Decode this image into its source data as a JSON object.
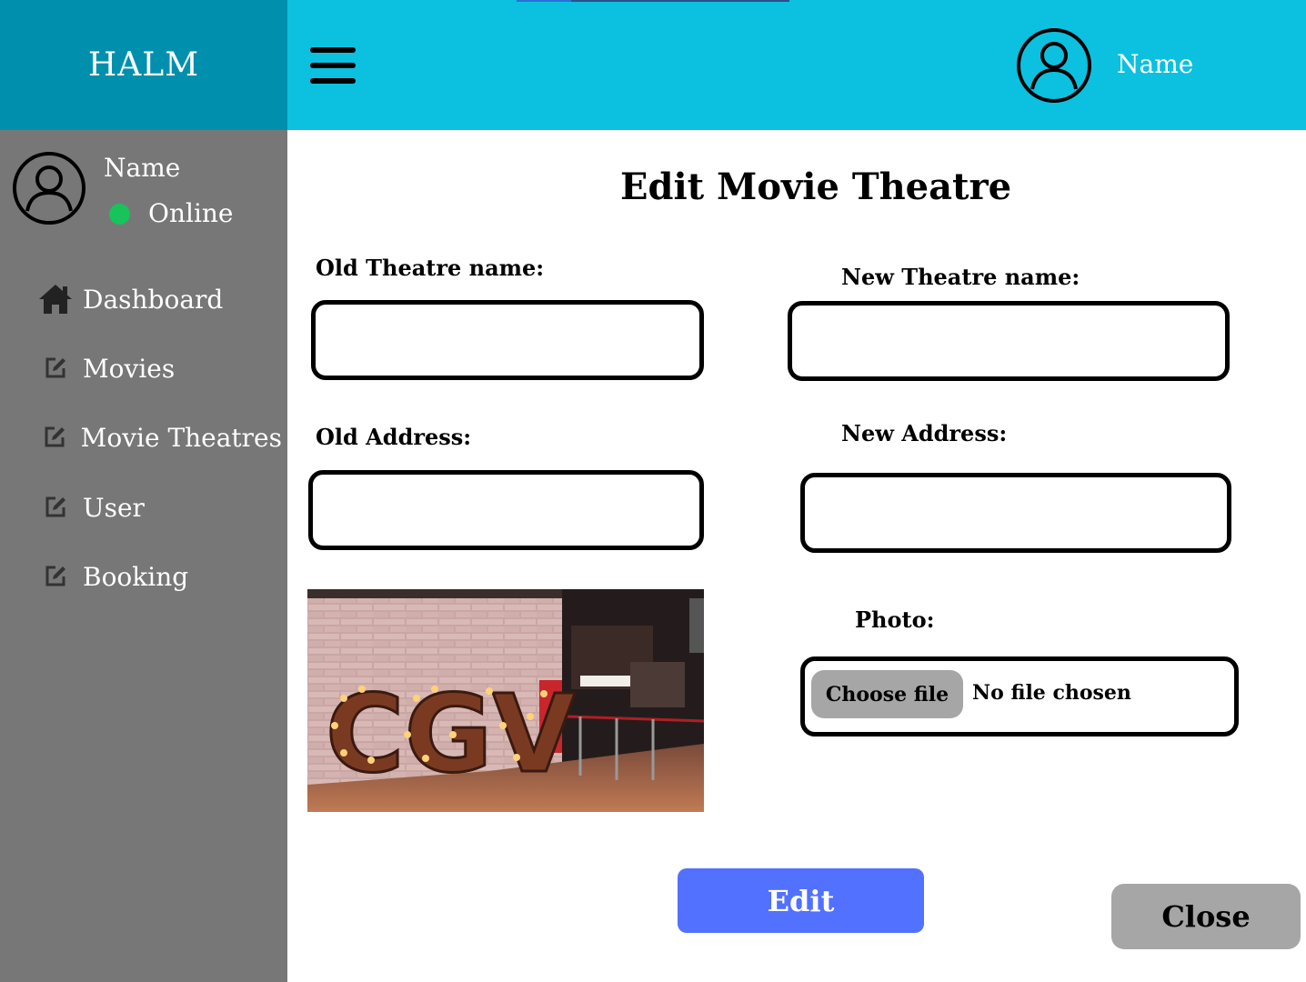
{
  "brand": {
    "title": "HALM"
  },
  "header": {
    "user_name": "Name",
    "menu_icon": "hamburger-menu-icon",
    "avatar_icon": "user-circle-icon"
  },
  "sidebar": {
    "user_name": "Name",
    "status": "Online",
    "status_color": "#16c45a",
    "items": [
      {
        "label": "Dashboard",
        "icon": "home-icon"
      },
      {
        "label": "Movies",
        "icon": "edit-icon"
      },
      {
        "label": "Movie Theatres",
        "icon": "edit-icon"
      },
      {
        "label": "User",
        "icon": "edit-icon"
      },
      {
        "label": "Booking",
        "icon": "edit-icon"
      }
    ]
  },
  "form": {
    "title": "Edit Movie Theatre",
    "old_name_label": "Old  Theatre name:",
    "old_name_value": "",
    "new_name_label": "New  Theatre name:",
    "new_name_value": "",
    "old_address_label": "Old Address:",
    "old_address_value": "",
    "new_address_label": "New Address:",
    "new_address_value": "",
    "photo_label": "Photo:",
    "choose_file_label": "Choose file",
    "no_file_text": "No file chosen",
    "photo_sign_text": "CGV",
    "edit_label": "Edit",
    "close_label": "Close"
  },
  "colors": {
    "header": "#0cc0df",
    "brand": "#0090ad",
    "sidebar": "#777777",
    "edit_button": "#5271ff",
    "close_button": "#a6a6a6"
  }
}
